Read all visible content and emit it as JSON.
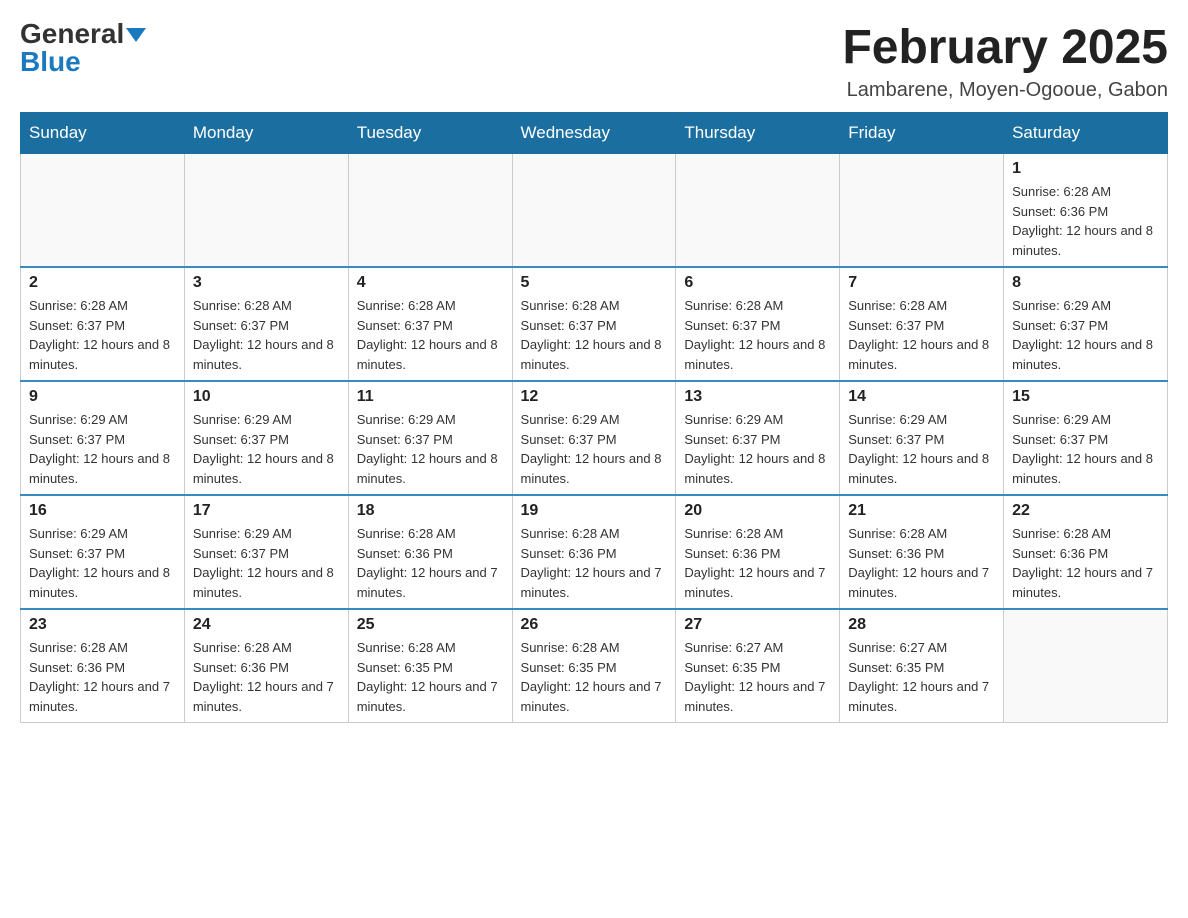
{
  "header": {
    "logo_general": "General",
    "logo_blue": "Blue",
    "main_title": "February 2025",
    "subtitle": "Lambarene, Moyen-Ogooue, Gabon"
  },
  "days_of_week": [
    "Sunday",
    "Monday",
    "Tuesday",
    "Wednesday",
    "Thursday",
    "Friday",
    "Saturday"
  ],
  "weeks": [
    [
      {
        "day": "",
        "info": ""
      },
      {
        "day": "",
        "info": ""
      },
      {
        "day": "",
        "info": ""
      },
      {
        "day": "",
        "info": ""
      },
      {
        "day": "",
        "info": ""
      },
      {
        "day": "",
        "info": ""
      },
      {
        "day": "1",
        "info": "Sunrise: 6:28 AM\nSunset: 6:36 PM\nDaylight: 12 hours and 8 minutes."
      }
    ],
    [
      {
        "day": "2",
        "info": "Sunrise: 6:28 AM\nSunset: 6:37 PM\nDaylight: 12 hours and 8 minutes."
      },
      {
        "day": "3",
        "info": "Sunrise: 6:28 AM\nSunset: 6:37 PM\nDaylight: 12 hours and 8 minutes."
      },
      {
        "day": "4",
        "info": "Sunrise: 6:28 AM\nSunset: 6:37 PM\nDaylight: 12 hours and 8 minutes."
      },
      {
        "day": "5",
        "info": "Sunrise: 6:28 AM\nSunset: 6:37 PM\nDaylight: 12 hours and 8 minutes."
      },
      {
        "day": "6",
        "info": "Sunrise: 6:28 AM\nSunset: 6:37 PM\nDaylight: 12 hours and 8 minutes."
      },
      {
        "day": "7",
        "info": "Sunrise: 6:28 AM\nSunset: 6:37 PM\nDaylight: 12 hours and 8 minutes."
      },
      {
        "day": "8",
        "info": "Sunrise: 6:29 AM\nSunset: 6:37 PM\nDaylight: 12 hours and 8 minutes."
      }
    ],
    [
      {
        "day": "9",
        "info": "Sunrise: 6:29 AM\nSunset: 6:37 PM\nDaylight: 12 hours and 8 minutes."
      },
      {
        "day": "10",
        "info": "Sunrise: 6:29 AM\nSunset: 6:37 PM\nDaylight: 12 hours and 8 minutes."
      },
      {
        "day": "11",
        "info": "Sunrise: 6:29 AM\nSunset: 6:37 PM\nDaylight: 12 hours and 8 minutes."
      },
      {
        "day": "12",
        "info": "Sunrise: 6:29 AM\nSunset: 6:37 PM\nDaylight: 12 hours and 8 minutes."
      },
      {
        "day": "13",
        "info": "Sunrise: 6:29 AM\nSunset: 6:37 PM\nDaylight: 12 hours and 8 minutes."
      },
      {
        "day": "14",
        "info": "Sunrise: 6:29 AM\nSunset: 6:37 PM\nDaylight: 12 hours and 8 minutes."
      },
      {
        "day": "15",
        "info": "Sunrise: 6:29 AM\nSunset: 6:37 PM\nDaylight: 12 hours and 8 minutes."
      }
    ],
    [
      {
        "day": "16",
        "info": "Sunrise: 6:29 AM\nSunset: 6:37 PM\nDaylight: 12 hours and 8 minutes."
      },
      {
        "day": "17",
        "info": "Sunrise: 6:29 AM\nSunset: 6:37 PM\nDaylight: 12 hours and 8 minutes."
      },
      {
        "day": "18",
        "info": "Sunrise: 6:28 AM\nSunset: 6:36 PM\nDaylight: 12 hours and 7 minutes."
      },
      {
        "day": "19",
        "info": "Sunrise: 6:28 AM\nSunset: 6:36 PM\nDaylight: 12 hours and 7 minutes."
      },
      {
        "day": "20",
        "info": "Sunrise: 6:28 AM\nSunset: 6:36 PM\nDaylight: 12 hours and 7 minutes."
      },
      {
        "day": "21",
        "info": "Sunrise: 6:28 AM\nSunset: 6:36 PM\nDaylight: 12 hours and 7 minutes."
      },
      {
        "day": "22",
        "info": "Sunrise: 6:28 AM\nSunset: 6:36 PM\nDaylight: 12 hours and 7 minutes."
      }
    ],
    [
      {
        "day": "23",
        "info": "Sunrise: 6:28 AM\nSunset: 6:36 PM\nDaylight: 12 hours and 7 minutes."
      },
      {
        "day": "24",
        "info": "Sunrise: 6:28 AM\nSunset: 6:36 PM\nDaylight: 12 hours and 7 minutes."
      },
      {
        "day": "25",
        "info": "Sunrise: 6:28 AM\nSunset: 6:35 PM\nDaylight: 12 hours and 7 minutes."
      },
      {
        "day": "26",
        "info": "Sunrise: 6:28 AM\nSunset: 6:35 PM\nDaylight: 12 hours and 7 minutes."
      },
      {
        "day": "27",
        "info": "Sunrise: 6:27 AM\nSunset: 6:35 PM\nDaylight: 12 hours and 7 minutes."
      },
      {
        "day": "28",
        "info": "Sunrise: 6:27 AM\nSunset: 6:35 PM\nDaylight: 12 hours and 7 minutes."
      },
      {
        "day": "",
        "info": ""
      }
    ]
  ]
}
